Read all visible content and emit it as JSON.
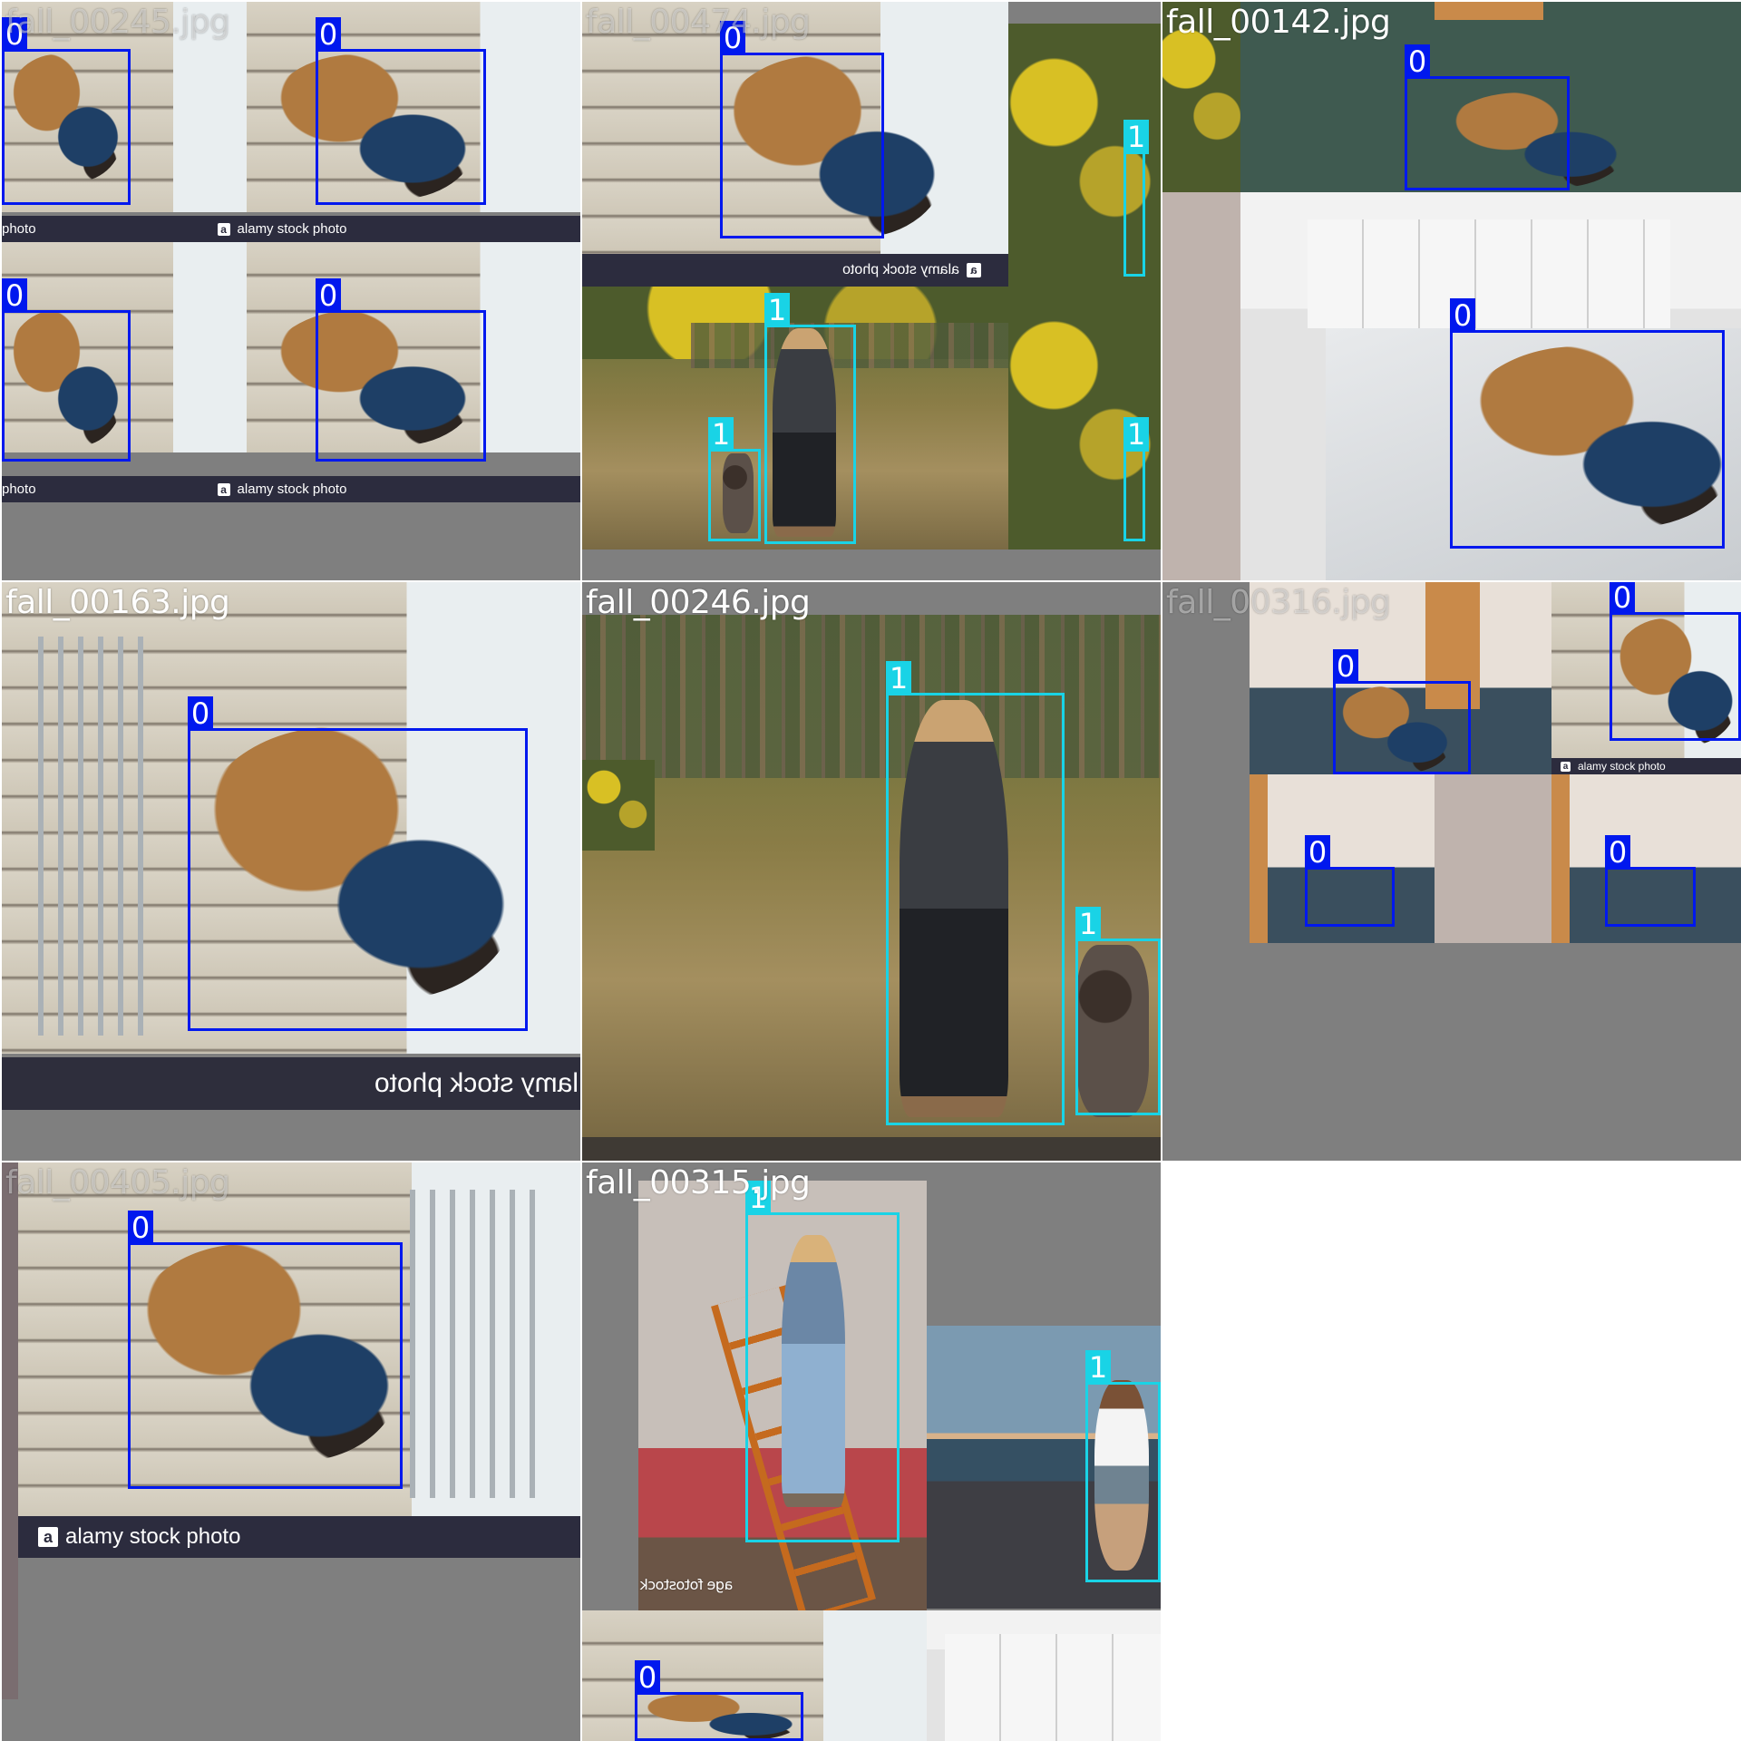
{
  "cells": [
    {
      "filename": "fall_00245.jpg"
    },
    {
      "filename": "fall_00474.jpg"
    },
    {
      "filename": "fall_00142.jpg"
    },
    {
      "filename": "fall_00163.jpg"
    },
    {
      "filename": "fall_00246.jpg"
    },
    {
      "filename": "fall_00316.jpg"
    },
    {
      "filename": "fall_00405.jpg"
    },
    {
      "filename": "fall_00315.jpg"
    }
  ],
  "labels": {
    "fall": "0",
    "person": "1"
  },
  "watermarks": {
    "alamy": "alamy stock photo",
    "alamy_short": "photo",
    "alamy_mirrored": "alamy stock photo",
    "alamy_cut_mirrored": "lamy stock photo",
    "age_fotostock": "age fotostock"
  },
  "colors": {
    "fall": "#0018ee",
    "person": "#19d3e6",
    "background": "#7f7f7f"
  }
}
